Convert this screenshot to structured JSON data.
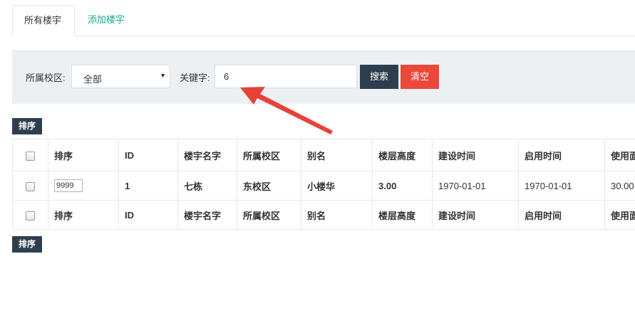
{
  "tabs": [
    {
      "label": "所有楼宇"
    },
    {
      "label": "添加楼宇"
    }
  ],
  "search": {
    "campus_label": "所属校区:",
    "campus_selected": "全部",
    "keyword_label": "关键字:",
    "keyword_value": "6",
    "search_button": "搜索",
    "clear_button": "清空"
  },
  "sort_button": "排序",
  "table": {
    "columns": [
      "排序",
      "ID",
      "楼宇名字",
      "所属校区",
      "别名",
      "楼层高度",
      "建设时间",
      "启用时间",
      "使用面"
    ],
    "rows": [
      {
        "sort": "9999",
        "id": "1",
        "name": "七栋",
        "campus": "东校区",
        "alias": "小楼华",
        "floor_height": "3.00",
        "build_date": "1970-01-01",
        "enable_date": "1970-01-01",
        "area": "30.00"
      }
    ]
  },
  "colors": {
    "accent_tab": "#1aaa8a",
    "dark_button": "#2e3e4e",
    "clear_button": "#e9483b",
    "annotation_arrow": "#e8413a"
  }
}
